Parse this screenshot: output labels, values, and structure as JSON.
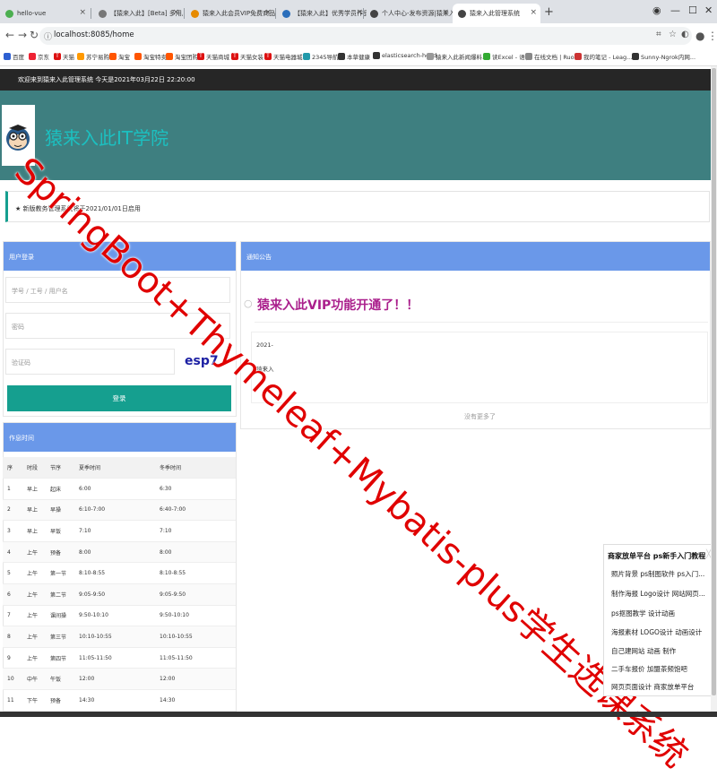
{
  "browser": {
    "tabs": [
      {
        "label": "hello-vue",
        "active": false
      },
      {
        "label": "【猿来入此】[Beta] 多用户版IT问",
        "active": false
      },
      {
        "label": "猿来入此会员VIP免费商品列表|",
        "active": false
      },
      {
        "label": "【猿来入此】优秀学员作品：Sp",
        "active": false
      },
      {
        "label": "个人中心-发布资源|猿来入此【",
        "active": false
      },
      {
        "label": "猿来入此管理系统",
        "active": true
      }
    ],
    "new_tab": "+",
    "url": "localhost:8085/home",
    "bookmarks": [
      "百度",
      "京东",
      "天猫",
      "苏宁易购",
      "淘宝",
      "淘宝特卖",
      "淘宝团购",
      "天猫商城",
      "天猫女装",
      "天猫电器城",
      "2345导航",
      "本草健康",
      "elasticsearch-head",
      "猿来入此新闻爆料...",
      "读Excel - 语雀",
      "在线文档 | RuoYi",
      "我的笔记 - Leag...",
      "Sunny-Ngrok内网..."
    ]
  },
  "header": {
    "welcome": "欢迎来到猿来入此管理系统  今天是2021年03月22日 22:20:00",
    "site_title": "猿来入此IT学院"
  },
  "notice": "★ 新版教务管理系统将于2021/01/01日启用",
  "login": {
    "title": "用户登录",
    "username_placeholder": "学号 / 工号 / 用户名",
    "password_placeholder": "密码",
    "captcha_placeholder": "验证码",
    "captcha_text": "esp7",
    "submit": "登录"
  },
  "announcement": {
    "title": "通知公告",
    "headline": "猿来入此VIP功能开通了！！",
    "date": "2021-",
    "author": "猿来入",
    "more": "没有更多了"
  },
  "schedule": {
    "title": "作息时间",
    "headers": [
      "序",
      "时段",
      "节序",
      "夏季时间",
      "冬季时间"
    ],
    "rows": [
      [
        "1",
        "早上",
        "起床",
        "6:00",
        "6:30"
      ],
      [
        "2",
        "早上",
        "早操",
        "6:10-7:00",
        "6:40-7:00"
      ],
      [
        "3",
        "早上",
        "早饭",
        "7:10",
        "7:10"
      ],
      [
        "4",
        "上午",
        "预备",
        "8:00",
        "8:00"
      ],
      [
        "5",
        "上午",
        "第一节",
        "8:10-8:55",
        "8:10-8:55"
      ],
      [
        "6",
        "上午",
        "第二节",
        "9:05-9:50",
        "9:05-9:50"
      ],
      [
        "7",
        "上午",
        "课间操",
        "9:50-10:10",
        "9:50-10:10"
      ],
      [
        "8",
        "上午",
        "第三节",
        "10:10-10:55",
        "10:10-10:55"
      ],
      [
        "9",
        "上午",
        "第四节",
        "11:05-11:50",
        "11:05-11:50"
      ],
      [
        "10",
        "中午",
        "午饭",
        "12:00",
        "12:00"
      ],
      [
        "11",
        "下午",
        "预备",
        "14:30",
        "14:30"
      ]
    ]
  },
  "ad": {
    "title": "商家放单平台  ps新手入门教程",
    "lines": [
      "照片背景  ps制图软件  ps入门...",
      "制作海报  Logo设计  网站网页...",
      "ps抠图教学  设计动画",
      "海报素材  LOGO设计  动画设计",
      "自己建网站  动画 制作",
      "二手车报价  加盟茶频饱吧",
      "网页页面设计  商家放单平台"
    ],
    "close": "╳"
  },
  "watermark": "SpringBoot+Thymeleaf+Mybatis-plus学生选课系统",
  "colors": {
    "banner": "#3e7f80",
    "panel_head": "#6a98e9",
    "primary_button": "#159f8f",
    "headline": "#aa1f8c",
    "watermark": "#e00000"
  }
}
